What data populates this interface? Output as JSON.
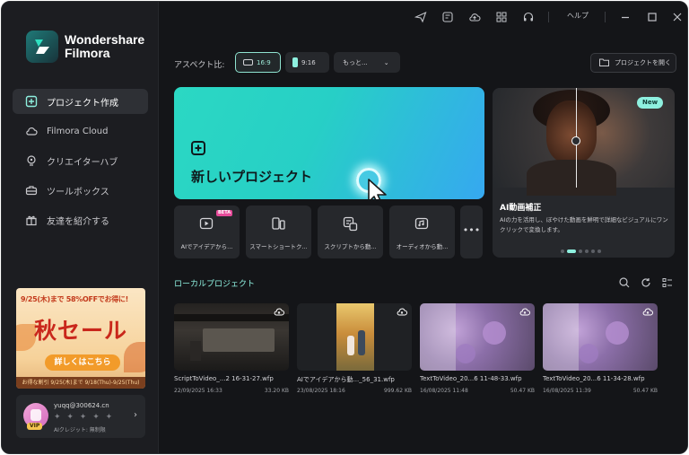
{
  "brand": {
    "line1": "Wondershare",
    "line2": "Filmora"
  },
  "sidebar": {
    "items": [
      {
        "label": "プロジェクト作成",
        "icon": "plus-square-icon",
        "active": true
      },
      {
        "label": "Filmora Cloud",
        "icon": "cloud-icon",
        "active": false
      },
      {
        "label": "クリエイターハブ",
        "icon": "bulb-icon",
        "active": false
      },
      {
        "label": "ツールボックス",
        "icon": "toolbox-icon",
        "active": false
      },
      {
        "label": "友達を紹介する",
        "icon": "gift-icon",
        "active": false
      }
    ]
  },
  "promo": {
    "line1": "9/25(木)まで 58%OFFでお得に!",
    "headline": "秋セール",
    "cta": "詳しくはこちら",
    "footer": "お得な割引 9/25(木)まで 9/18(Thu)-9/25(Thu)"
  },
  "user": {
    "email": "yuqq@300624.cn",
    "icons": "✦ ✦ ✦ ✦ ✦",
    "credit": "AIクレジット: 無制限",
    "vip": "VIP"
  },
  "titlebar": {
    "icons": [
      "send-icon",
      "save-project-icon",
      "cloud-upload-icon",
      "grid-icon",
      "headset-icon"
    ],
    "help": "ヘルプ"
  },
  "aspect": {
    "label": "アスペクト比:",
    "options": [
      {
        "label": "16:9",
        "selected": true
      },
      {
        "label": "9:16",
        "selected": false
      }
    ],
    "more": "もっと...",
    "open_project": "プロジェクトを開く"
  },
  "hero": {
    "title": "新しいプロジェクト"
  },
  "featured": {
    "badge": "New",
    "title": "AI動画補正",
    "description": "AIの力を活用し、ぼやけた動画を鮮明で詳細なビジュアルにワンクリックで変換します。"
  },
  "tools": [
    {
      "label": "AIでアイデアから...",
      "icon": "ai-idea-icon",
      "beta": "BETA"
    },
    {
      "label": "スマートショートク...",
      "icon": "smart-short-icon"
    },
    {
      "label": "スクリプトから動...",
      "icon": "script-video-icon"
    },
    {
      "label": "オーディオから動...",
      "icon": "audio-video-icon"
    }
  ],
  "tools_more": "•••",
  "local_projects": {
    "title": "ローカルプロジェクト",
    "items": [
      {
        "name": "ScriptToVideo_...2 16-31-27.wfp",
        "date": "22/09/2025 16:33",
        "size": "33.20 KB"
      },
      {
        "name": "AIでアイデアから動..._56_31.wfp",
        "date": "23/08/2025 18:16",
        "size": "999.62 KB"
      },
      {
        "name": "TextToVideo_20...6 11-48-33.wfp",
        "date": "16/08/2025 11:48",
        "size": "50.47 KB"
      },
      {
        "name": "TextToVideo_20...6 11-34-28.wfp",
        "date": "16/08/2025 11:39",
        "size": "50.47 KB"
      }
    ]
  },
  "colors": {
    "accent": "#8ef0df",
    "hero_start": "#2bd8c3",
    "hero_end": "#36a8f0",
    "background": "#141518"
  }
}
